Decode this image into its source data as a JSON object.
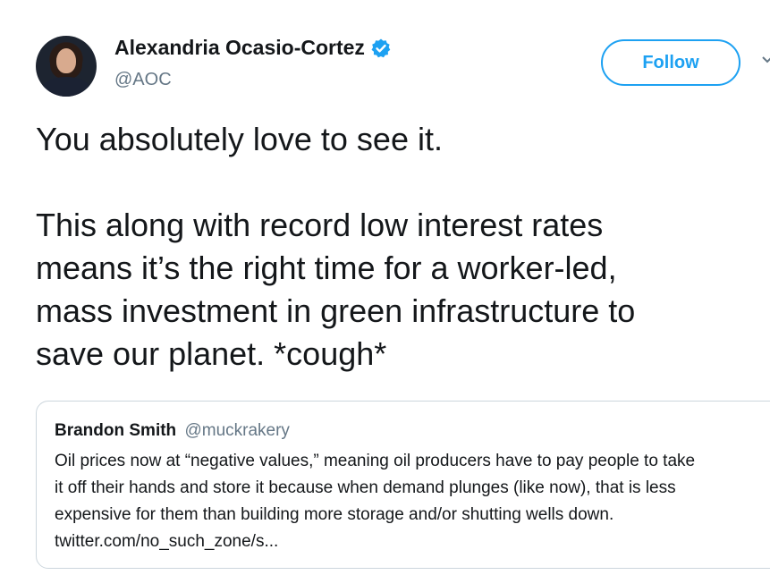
{
  "author": {
    "display_name": "Alexandria Ocasio-Cortez",
    "handle": "@AOC",
    "verified": true
  },
  "follow_button": {
    "label": "Follow"
  },
  "tweet": {
    "paragraph_1": "You absolutely love to see it.",
    "paragraph_2_lines": [
      "This along with record low interest rates",
      "means it’s the right time for a worker-led,",
      "mass investment in green infrastructure to",
      "save our planet. *cough*"
    ]
  },
  "quoted_tweet": {
    "display_name": "Brandon Smith",
    "handle": "@muckrakery",
    "lines": [
      "Oil prices now at “negative values,” meaning oil producers have to pay people to take",
      "it off their hands and store it because when demand plunges (like now), that is less",
      "expensive for them than building more storage and/or shutting wells down.",
      "twitter.com/no_such_zone/s..."
    ]
  },
  "colors": {
    "accent": "#1da1f2",
    "text": "#14171a",
    "secondary_text": "#657786",
    "border": "#ccd6dd"
  },
  "icons": [
    "avatar",
    "verified-badge-icon",
    "chevron-down-icon"
  ]
}
